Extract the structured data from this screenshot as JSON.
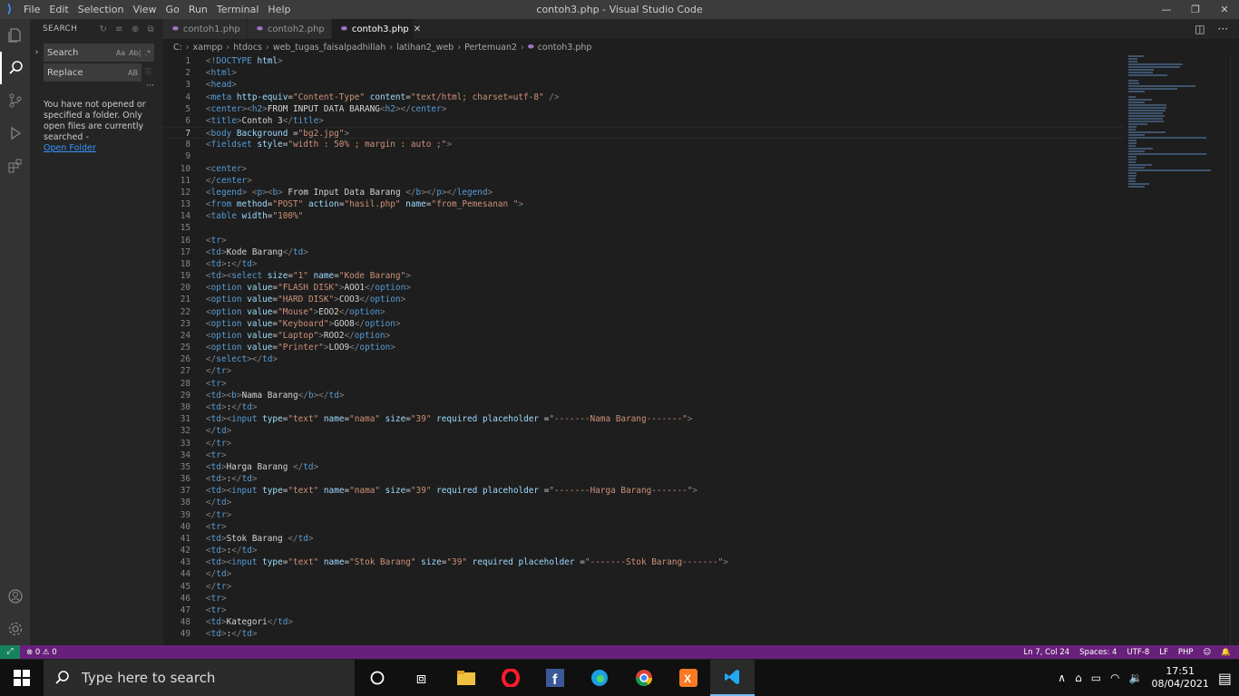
{
  "titlebar": {
    "title": "contoh3.php - Visual Studio Code",
    "menu": [
      "File",
      "Edit",
      "Selection",
      "View",
      "Go",
      "Run",
      "Terminal",
      "Help"
    ]
  },
  "sidebar": {
    "header": "SEARCH",
    "search_placeholder": "Search",
    "replace_placeholder": "Replace",
    "message": "You have not opened or specified a folder. Only open files are currently searched -",
    "open_folder_link": "Open Folder",
    "search_options": [
      "Aa",
      "Ab|",
      ".*"
    ],
    "replace_option": "AB"
  },
  "tabs": [
    {
      "label": "contoh1.php",
      "active": false
    },
    {
      "label": "contoh2.php",
      "active": false
    },
    {
      "label": "contoh3.php",
      "active": true
    }
  ],
  "breadcrumb": [
    "C:",
    "xampp",
    "htdocs",
    "web_tugas_faisalpadhillah",
    "latihan2_web",
    "Pertemuan2",
    "contoh3.php"
  ],
  "editor": {
    "current_line": 7,
    "lines": [
      {
        "n": "1",
        "h": "<span class='t'>&lt;!</span><span class='n'>DOCTYPE</span> <span class='a'>html</span><span class='t'>&gt;</span>"
      },
      {
        "n": "2",
        "h": "<span class='t'>&lt;</span><span class='n'>html</span><span class='t'>&gt;</span>"
      },
      {
        "n": "3",
        "h": "<span class='t'>&lt;</span><span class='n'>head</span><span class='t'>&gt;</span>"
      },
      {
        "n": "4",
        "h": "<span class='t'>&lt;</span><span class='n'>meta</span> <span class='a'>http-equiv</span><span class='x'>=</span><span class='s'>\"Content-Type\"</span> <span class='a'>content</span><span class='x'>=</span><span class='s'>\"text/html; charset=utf-8\"</span> <span class='t'>/&gt;</span>"
      },
      {
        "n": "5",
        "h": "<span class='t'>&lt;</span><span class='n'>center</span><span class='t'>&gt;&lt;</span><span class='n'>h2</span><span class='t'>&gt;</span><span class='x'>FROM INPUT DATA BARANG</span><span class='t'>&lt;</span><span class='n'>h2</span><span class='t'>&gt;&lt;/</span><span class='n'>center</span><span class='t'>&gt;</span>"
      },
      {
        "n": "6",
        "h": "<span class='t'>&lt;</span><span class='n'>title</span><span class='t'>&gt;</span><span class='x'>Contoh 3</span><span class='t'>&lt;/</span><span class='n'>title</span><span class='t'>&gt;</span>"
      },
      {
        "n": "7",
        "h": "<span class='t'>&lt;</span><span class='n'>body</span> <span class='a'>Background</span> <span class='x'>=</span><span class='s'>\"bg2.jpg\"</span><span class='t'>&gt;</span>"
      },
      {
        "n": "8",
        "h": "<span class='t'>&lt;</span><span class='n'>fieldset</span> <span class='a'>style</span><span class='x'>=</span><span class='s'>\"width : 50% ; margin : auto ;\"</span><span class='t'>&gt;</span>"
      },
      {
        "n": "9",
        "h": ""
      },
      {
        "n": "10",
        "h": "<span class='t'>&lt;</span><span class='n'>center</span><span class='t'>&gt;</span>"
      },
      {
        "n": "11",
        "h": "<span class='t'>&lt;/</span><span class='n'>center</span><span class='t'>&gt;</span>"
      },
      {
        "n": "12",
        "h": "<span class='t'>&lt;</span><span class='n'>legend</span><span class='t'>&gt;</span> <span class='t'>&lt;</span><span class='n'>p</span><span class='t'>&gt;&lt;</span><span class='n'>b</span><span class='t'>&gt;</span><span class='x'> From Input Data Barang </span><span class='t'>&lt;/</span><span class='n'>b</span><span class='t'>&gt;&lt;/</span><span class='n'>p</span><span class='t'>&gt;&lt;/</span><span class='n'>legend</span><span class='t'>&gt;</span>"
      },
      {
        "n": "13",
        "h": "<span class='t'>&lt;</span><span class='n'>from</span> <span class='a'>method</span><span class='x'>=</span><span class='s'>\"POST\"</span> <span class='a'>action</span><span class='x'>=</span><span class='s'>\"hasil.php\"</span> <span class='a'>name</span><span class='x'>=</span><span class='s'>\"from_Pemesanan \"</span><span class='t'>&gt;</span>"
      },
      {
        "n": "14",
        "h": "<span class='t'>&lt;</span><span class='n'>table</span> <span class='a'>width</span><span class='x'>=</span><span class='s'>\"100%\"</span>"
      },
      {
        "n": "15",
        "h": ""
      },
      {
        "n": "16",
        "h": "<span class='t'>&lt;</span><span class='n'>tr</span><span class='t'>&gt;</span>"
      },
      {
        "n": "17",
        "h": "<span class='t'>&lt;</span><span class='n'>td</span><span class='t'>&gt;</span><span class='x'>Kode Barang</span><span class='t'>&lt;/</span><span class='n'>td</span><span class='t'>&gt;</span>"
      },
      {
        "n": "18",
        "h": "<span class='t'>&lt;</span><span class='n'>td</span><span class='t'>&gt;</span><span class='x'>:</span><span class='t'>&lt;/</span><span class='n'>td</span><span class='t'>&gt;</span>"
      },
      {
        "n": "19",
        "h": "<span class='t'>&lt;</span><span class='n'>td</span><span class='t'>&gt;&lt;</span><span class='n'>select</span> <span class='a'>size</span><span class='x'>=</span><span class='s'>\"1\"</span> <span class='a'>name</span><span class='x'>=</span><span class='s'>\"Kode Barang\"</span><span class='t'>&gt;</span>"
      },
      {
        "n": "20",
        "h": "<span class='t'>&lt;</span><span class='n'>option</span> <span class='a'>value</span><span class='x'>=</span><span class='s'>\"FLASH DISK\"</span><span class='t'>&gt;</span><span class='x'>AOO1</span><span class='t'>&lt;/</span><span class='n'>option</span><span class='t'>&gt;</span>"
      },
      {
        "n": "21",
        "h": "<span class='t'>&lt;</span><span class='n'>option</span> <span class='a'>value</span><span class='x'>=</span><span class='s'>\"HARD DISK\"</span><span class='t'>&gt;</span><span class='x'>COO3</span><span class='t'>&lt;/</span><span class='n'>option</span><span class='t'>&gt;</span>"
      },
      {
        "n": "22",
        "h": "<span class='t'>&lt;</span><span class='n'>option</span> <span class='a'>value</span><span class='x'>=</span><span class='s'>\"Mouse\"</span><span class='t'>&gt;</span><span class='x'>EOO2</span><span class='t'>&lt;/</span><span class='n'>option</span><span class='t'>&gt;</span>"
      },
      {
        "n": "23",
        "h": "<span class='t'>&lt;</span><span class='n'>option</span> <span class='a'>value</span><span class='x'>=</span><span class='s'>\"Keyboard\"</span><span class='t'>&gt;</span><span class='x'>GOO8</span><span class='t'>&lt;/</span><span class='n'>option</span><span class='t'>&gt;</span>"
      },
      {
        "n": "24",
        "h": "<span class='t'>&lt;</span><span class='n'>option</span> <span class='a'>value</span><span class='x'>=</span><span class='s'>\"Laptop\"</span><span class='t'>&gt;</span><span class='x'>ROO2</span><span class='t'>&lt;/</span><span class='n'>option</span><span class='t'>&gt;</span>"
      },
      {
        "n": "25",
        "h": "<span class='t'>&lt;</span><span class='n'>option</span> <span class='a'>value</span><span class='x'>=</span><span class='s'>\"Printer\"</span><span class='t'>&gt;</span><span class='x'>LOO9</span><span class='t'>&lt;/</span><span class='n'>option</span><span class='t'>&gt;</span>"
      },
      {
        "n": "26",
        "h": "<span class='t'>&lt;/</span><span class='n'>select</span><span class='t'>&gt;&lt;/</span><span class='n'>td</span><span class='t'>&gt;</span>"
      },
      {
        "n": "27",
        "h": "<span class='t'>&lt;/</span><span class='n'>tr</span><span class='t'>&gt;</span>"
      },
      {
        "n": "28",
        "h": "<span class='t'>&lt;</span><span class='n'>tr</span><span class='t'>&gt;</span>"
      },
      {
        "n": "29",
        "h": "<span class='t'>&lt;</span><span class='n'>td</span><span class='t'>&gt;&lt;</span><span class='n'>b</span><span class='t'>&gt;</span><span class='x'>Nama Barang</span><span class='t'>&lt;/</span><span class='n'>b</span><span class='t'>&gt;&lt;/</span><span class='n'>td</span><span class='t'>&gt;</span>"
      },
      {
        "n": "30",
        "h": "<span class='t'>&lt;</span><span class='n'>td</span><span class='t'>&gt;</span><span class='x'>:</span><span class='t'>&lt;/</span><span class='n'>td</span><span class='t'>&gt;</span>"
      },
      {
        "n": "31",
        "h": "<span class='t'>&lt;</span><span class='n'>td</span><span class='t'>&gt;&lt;</span><span class='n'>input</span> <span class='a'>type</span><span class='x'>=</span><span class='s'>\"text\"</span> <span class='a'>name</span><span class='x'>=</span><span class='s'>\"nama\"</span> <span class='a'>size</span><span class='x'>=</span><span class='s'>\"39\"</span> <span class='a'>required</span> <span class='a'>placeholder</span> <span class='x'>=</span><span class='s'>\"-------Nama Barang-------\"</span><span class='t'>&gt;</span>"
      },
      {
        "n": "32",
        "h": "<span class='t'>&lt;/</span><span class='n'>td</span><span class='t'>&gt;</span>"
      },
      {
        "n": "33",
        "h": "<span class='t'>&lt;/</span><span class='n'>tr</span><span class='t'>&gt;</span>"
      },
      {
        "n": "34",
        "h": "<span class='t'>&lt;</span><span class='n'>tr</span><span class='t'>&gt;</span>"
      },
      {
        "n": "35",
        "h": "<span class='t'>&lt;</span><span class='n'>td</span><span class='t'>&gt;</span><span class='x'>Harga Barang </span><span class='t'>&lt;/</span><span class='n'>td</span><span class='t'>&gt;</span>"
      },
      {
        "n": "36",
        "h": "<span class='t'>&lt;</span><span class='n'>td</span><span class='t'>&gt;</span><span class='x'>:</span><span class='t'>&lt;/</span><span class='n'>td</span><span class='t'>&gt;</span>"
      },
      {
        "n": "37",
        "h": "<span class='t'>&lt;</span><span class='n'>td</span><span class='t'>&gt;&lt;</span><span class='n'>input</span> <span class='a'>type</span><span class='x'>=</span><span class='s'>\"text\"</span> <span class='a'>name</span><span class='x'>=</span><span class='s'>\"nama\"</span> <span class='a'>size</span><span class='x'>=</span><span class='s'>\"39\"</span> <span class='a'>required</span> <span class='a'>placeholder</span> <span class='x'>=</span><span class='s'>\"-------Harga Barang-------\"</span><span class='t'>&gt;</span>"
      },
      {
        "n": "38",
        "h": "<span class='t'>&lt;/</span><span class='n'>td</span><span class='t'>&gt;</span>"
      },
      {
        "n": "39",
        "h": "<span class='t'>&lt;/</span><span class='n'>tr</span><span class='t'>&gt;</span>"
      },
      {
        "n": "40",
        "h": "<span class='t'>&lt;</span><span class='n'>tr</span><span class='t'>&gt;</span>"
      },
      {
        "n": "41",
        "h": "<span class='t'>&lt;</span><span class='n'>td</span><span class='t'>&gt;</span><span class='x'>Stok Barang </span><span class='t'>&lt;/</span><span class='n'>td</span><span class='t'>&gt;</span>"
      },
      {
        "n": "42",
        "h": "<span class='t'>&lt;</span><span class='n'>td</span><span class='t'>&gt;</span><span class='x'>:</span><span class='t'>&lt;/</span><span class='n'>td</span><span class='t'>&gt;</span>"
      },
      {
        "n": "43",
        "h": "<span class='t'>&lt;</span><span class='n'>td</span><span class='t'>&gt;&lt;</span><span class='n'>input</span> <span class='a'>type</span><span class='x'>=</span><span class='s'>\"text\"</span> <span class='a'>name</span><span class='x'>=</span><span class='s'>\"Stok Barang\"</span> <span class='a'>size</span><span class='x'>=</span><span class='s'>\"39\"</span> <span class='a'>required</span> <span class='a'>placeholder</span> <span class='x'>=</span><span class='s'>\"-------Stok Barang-------\"</span><span class='t'>&gt;</span>"
      },
      {
        "n": "44",
        "h": "<span class='t'>&lt;/</span><span class='n'>td</span><span class='t'>&gt;</span>"
      },
      {
        "n": "45",
        "h": "<span class='t'>&lt;/</span><span class='n'>tr</span><span class='t'>&gt;</span>"
      },
      {
        "n": "46",
        "h": "<span class='t'>&lt;</span><span class='n'>tr</span><span class='t'>&gt;</span>"
      },
      {
        "n": "47",
        "h": "<span class='t'>&lt;</span><span class='n'>tr</span><span class='t'>&gt;</span>"
      },
      {
        "n": "48",
        "h": "<span class='t'>&lt;</span><span class='n'>td</span><span class='t'>&gt;</span><span class='x'>Kategori</span><span class='t'>&lt;/</span><span class='n'>td</span><span class='t'>&gt;</span>"
      },
      {
        "n": "49",
        "h": "<span class='t'>&lt;</span><span class='n'>td</span><span class='t'>&gt;</span><span class='x'>:</span><span class='t'>&lt;/</span><span class='n'>td</span><span class='t'>&gt;</span>"
      }
    ]
  },
  "statusbar": {
    "problems": "⊗ 0 ⚠ 0",
    "position": "Ln 7, Col 24",
    "spaces": "Spaces: 4",
    "encoding": "UTF-8",
    "eol": "LF",
    "language": "PHP"
  },
  "taskbar": {
    "search_placeholder": "Type here to search",
    "time": "17:51",
    "date": "08/04/2021"
  },
  "colors": {
    "statusbar": "#68217a",
    "accent": "#3794ff",
    "remote": "#16825d"
  }
}
